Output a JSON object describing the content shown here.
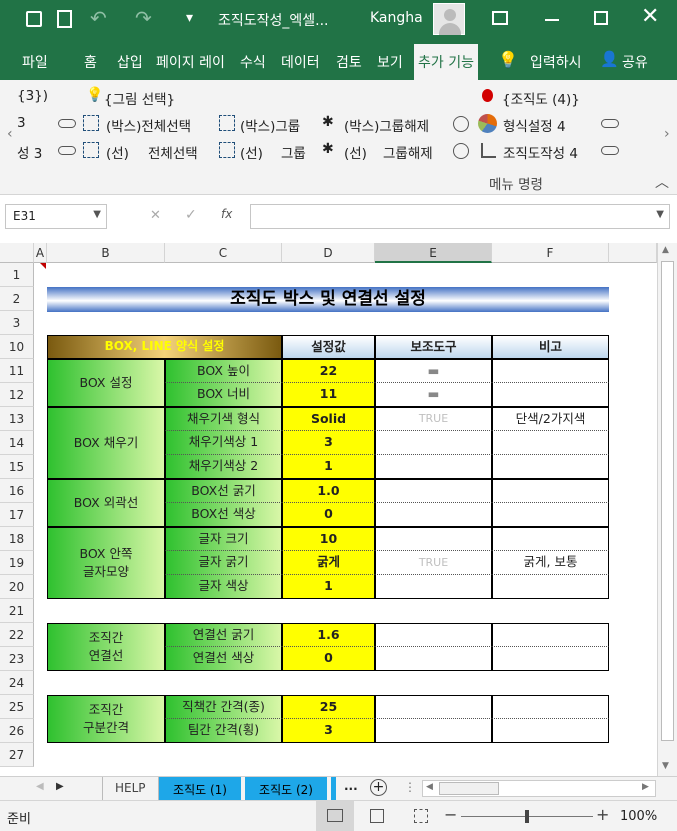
{
  "window": {
    "doc_title": "조직도작성_엑셀...",
    "user": "Kangha"
  },
  "tabs": [
    "파일",
    "홈",
    "삽입",
    "페이지 레이",
    "수식",
    "데이터",
    "검토",
    "보기",
    "추가 기능"
  ],
  "tell_me": "입력하시",
  "share": "공유",
  "ribbon": {
    "r0": [
      "{3})",
      "{그림 선택}",
      "{조직도 (4)}"
    ],
    "r1": [
      "3",
      "(박스)전체선택",
      "(박스)그룹",
      "(박스)그룹해제",
      "형식설정 4"
    ],
    "r2": [
      "성 3",
      "(선)",
      "전체선택",
      "(선)",
      "그룹",
      "(선)",
      "그룹해제",
      "조직도작성 4"
    ],
    "group_label": "메뉴 명령"
  },
  "formula": {
    "name_box": "E31",
    "fx": "fx",
    "value": ""
  },
  "columns": [
    "A",
    "B",
    "C",
    "D",
    "E",
    "F"
  ],
  "rows": [
    "1",
    "2",
    "3",
    "10",
    "11",
    "12",
    "13",
    "14",
    "15",
    "16",
    "17",
    "18",
    "19",
    "20",
    "21",
    "22",
    "23",
    "24",
    "25",
    "26",
    "27"
  ],
  "sheet": {
    "title": "조직도 박스 및 연결선 설정",
    "header": {
      "label": "BOX, LINE 양식 설정",
      "value": "설정값",
      "tool": "보조도구",
      "note": "비고"
    },
    "groups": [
      {
        "name": "BOX 설정",
        "items": [
          "BOX 높이",
          "BOX 너비"
        ],
        "values": [
          "22",
          "11"
        ],
        "tools": [
          "▬",
          "▬"
        ],
        "notes": [
          "",
          ""
        ]
      },
      {
        "name": "BOX 채우기",
        "items": [
          "채우기색 형식",
          "채우기색상 1",
          "채우기색상 2"
        ],
        "values": [
          "Solid",
          "3",
          "1"
        ],
        "tools": [
          "TRUE",
          "",
          ""
        ],
        "notes": [
          "단색/2가지색",
          "",
          ""
        ]
      },
      {
        "name": "BOX 외곽선",
        "items": [
          "BOX선 굵기",
          "BOX선 색상"
        ],
        "values": [
          "1.0",
          "0"
        ],
        "tools": [
          "",
          ""
        ],
        "notes": [
          "",
          ""
        ]
      },
      {
        "name": "BOX 안쪽\n글자모양",
        "items": [
          "글자 크기",
          "글자 굵기",
          "글자 색상"
        ],
        "values": [
          "10",
          "굵게",
          "1"
        ],
        "tools": [
          "",
          "TRUE",
          ""
        ],
        "notes": [
          "",
          "굵게, 보통",
          ""
        ]
      },
      {
        "name": "조직간\n연결선",
        "items": [
          "연결선 굵기",
          "연결선 색상"
        ],
        "values": [
          "1.6",
          "0"
        ],
        "tools": [
          "",
          ""
        ],
        "notes": [
          "",
          ""
        ]
      },
      {
        "name": "조직간\n구분간격",
        "items": [
          "직책간 간격(종)",
          "팀간 간격(횡)"
        ],
        "values": [
          "25",
          "3"
        ],
        "tools": [
          "",
          ""
        ],
        "notes": [
          "",
          ""
        ]
      }
    ]
  },
  "sheet_tabs": [
    "HELP",
    "조직도 (1)",
    "조직도 (2)",
    "..."
  ],
  "status": {
    "ready": "준비",
    "zoom": "100%"
  }
}
